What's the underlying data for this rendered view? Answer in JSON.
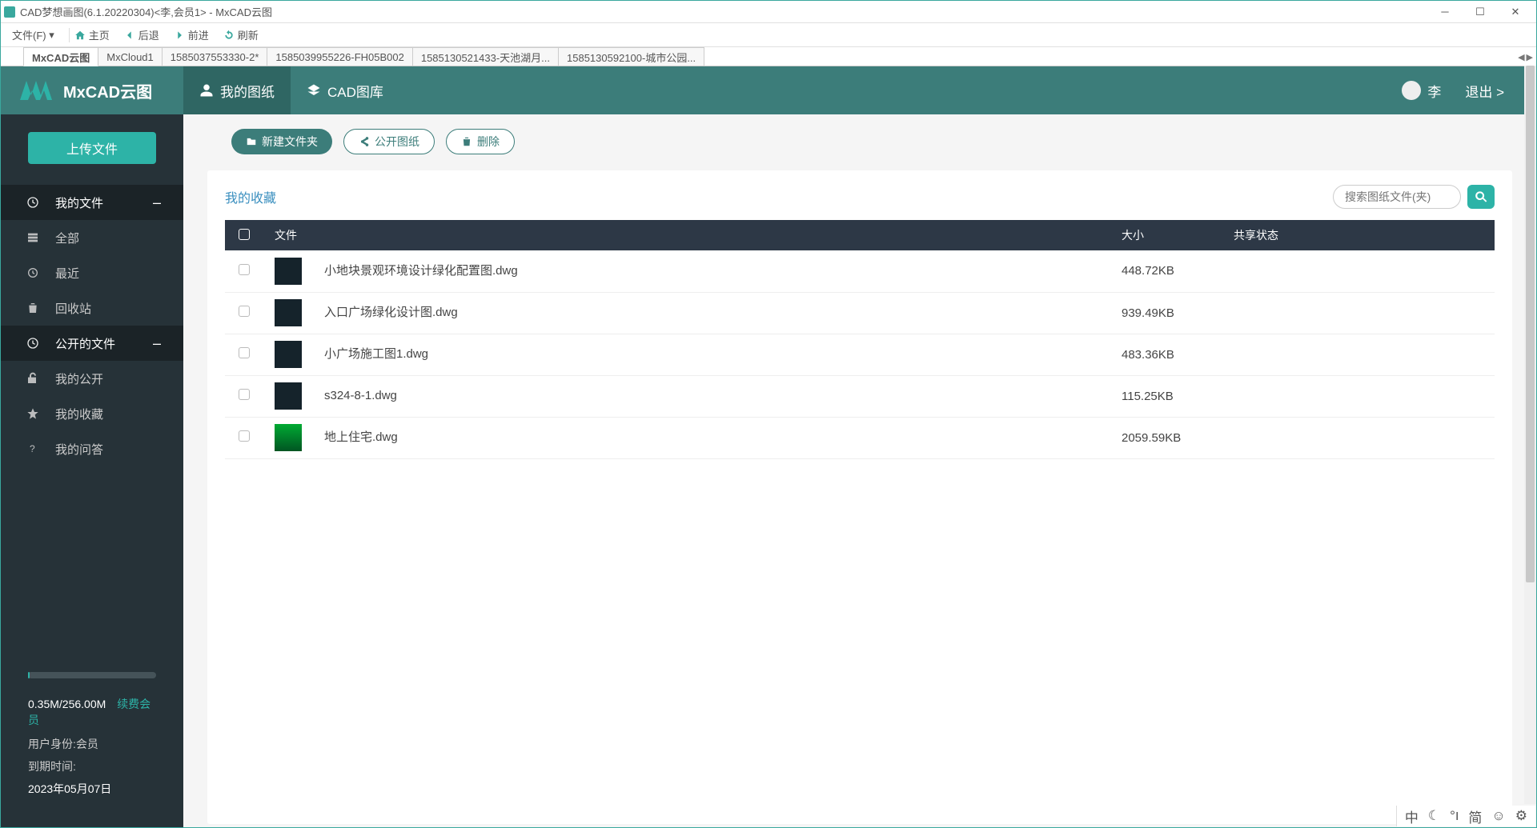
{
  "window_title": "CAD梦想画图(6.1.20220304)<李,会员1> - MxCAD云图",
  "toolbar": {
    "file": "文件(F)",
    "home": "主页",
    "back": "后退",
    "forward": "前进",
    "refresh": "刷新"
  },
  "tabs": [
    "MxCAD云图",
    "MxCloud1",
    "1585037553330-2*",
    "1585039955226-FH05B002",
    "1585130521433-天池湖月...",
    "1585130592100-城市公园..."
  ],
  "active_tab_index": 0,
  "brand": "MxCAD云图",
  "nav": {
    "my_drawings": "我的图纸",
    "cad_gallery": "CAD图库"
  },
  "user": {
    "name": "李",
    "logout": "退出 >"
  },
  "upload_label": "上传文件",
  "sidebar": {
    "my_files": "我的文件",
    "all": "全部",
    "recent": "最近",
    "recycle": "回收站",
    "public_files": "公开的文件",
    "my_public": "我的公开",
    "my_fav": "我的收藏",
    "my_qa": "我的问答"
  },
  "storage": {
    "used_total": "0.35M/256.00M",
    "renew": "续费会员",
    "role_label": "用户身份:会员",
    "expire_label": "到期时间:",
    "expire_date": "2023年05月07日"
  },
  "actions": {
    "new_folder": "新建文件夹",
    "public_drawing": "公开图纸",
    "delete": "删除"
  },
  "breadcrumb": "我的收藏",
  "search_placeholder": "搜索图纸文件(夹)",
  "table": {
    "columns": {
      "file": "文件",
      "size": "大小",
      "share": "共享状态"
    },
    "rows": [
      {
        "name": "小地块景观环境设计绿化配置图.dwg",
        "size": "448.72KB"
      },
      {
        "name": "入口广场绿化设计图.dwg",
        "size": "939.49KB"
      },
      {
        "name": "小广场施工图1.dwg",
        "size": "483.36KB"
      },
      {
        "name": "s324-8-1.dwg",
        "size": "115.25KB"
      },
      {
        "name": "地上住宅.dwg",
        "size": "2059.59KB"
      }
    ]
  },
  "ime": [
    "中",
    "简"
  ]
}
